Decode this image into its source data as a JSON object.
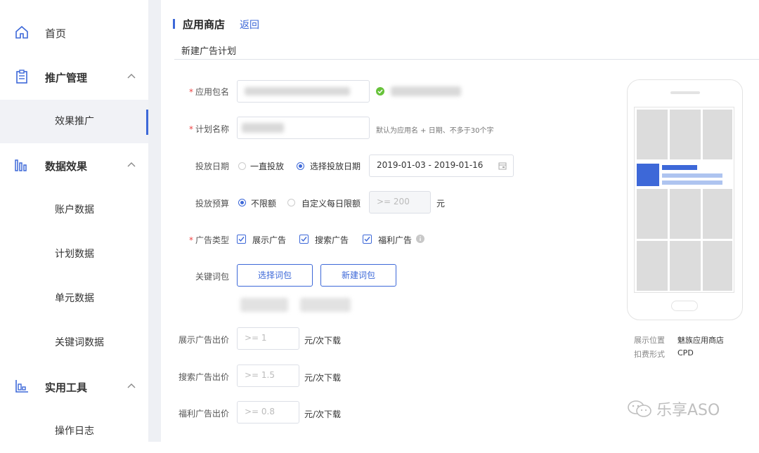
{
  "sidebar": {
    "items": [
      {
        "label": "首页",
        "icon": "home-icon"
      },
      {
        "label": "推广管理",
        "icon": "clipboard-icon"
      },
      {
        "label": "效果推广"
      },
      {
        "label": "数据效果",
        "icon": "bar-chart-icon"
      },
      {
        "label": "账户数据"
      },
      {
        "label": "计划数据"
      },
      {
        "label": "单元数据"
      },
      {
        "label": "关键词数据"
      },
      {
        "label": "实用工具",
        "icon": "tools-icon"
      },
      {
        "label": "操作日志"
      }
    ]
  },
  "header": {
    "title": "应用商店",
    "back_label": "返回"
  },
  "form": {
    "subtitle": "新建广告计划",
    "app_package_label": "应用包名",
    "plan_name_label": "计划名称",
    "plan_name_hint": "默认为应用名 + 日期、不多于30个字",
    "date_label": "投放日期",
    "date_opt_always": "一直投放",
    "date_opt_select": "选择投放日期",
    "date_range": "2019-01-03 - 2019-01-16",
    "budget_label": "投放预算",
    "budget_opt_unlimited": "不限额",
    "budget_opt_custom": "自定义每日限额",
    "budget_placeholder": ">= 200",
    "budget_unit": "元",
    "ad_type_label": "广告类型",
    "ad_type_display": "展示广告",
    "ad_type_search": "搜索广告",
    "ad_type_welfare": "福利广告",
    "keyword_label": "关键词包",
    "select_keyword_btn": "选择词包",
    "new_keyword_btn": "新建词包",
    "bid_display_label": "展示广告出价",
    "bid_display_placeholder": ">= 1",
    "bid_search_label": "搜索广告出价",
    "bid_search_placeholder": ">= 1.5",
    "bid_welfare_label": "福利广告出价",
    "bid_welfare_placeholder": ">= 0.8",
    "bid_unit": "元/次下载"
  },
  "preview": {
    "position_label": "展示位置",
    "position_value": "魅族应用商店",
    "charge_label": "扣费形式",
    "charge_value": "CPD"
  },
  "watermark": "乐享ASO",
  "colors": {
    "accent": "#3d68d8",
    "placeholder_tile": "#dcdcdc",
    "light_blue": "#aec4f0"
  }
}
